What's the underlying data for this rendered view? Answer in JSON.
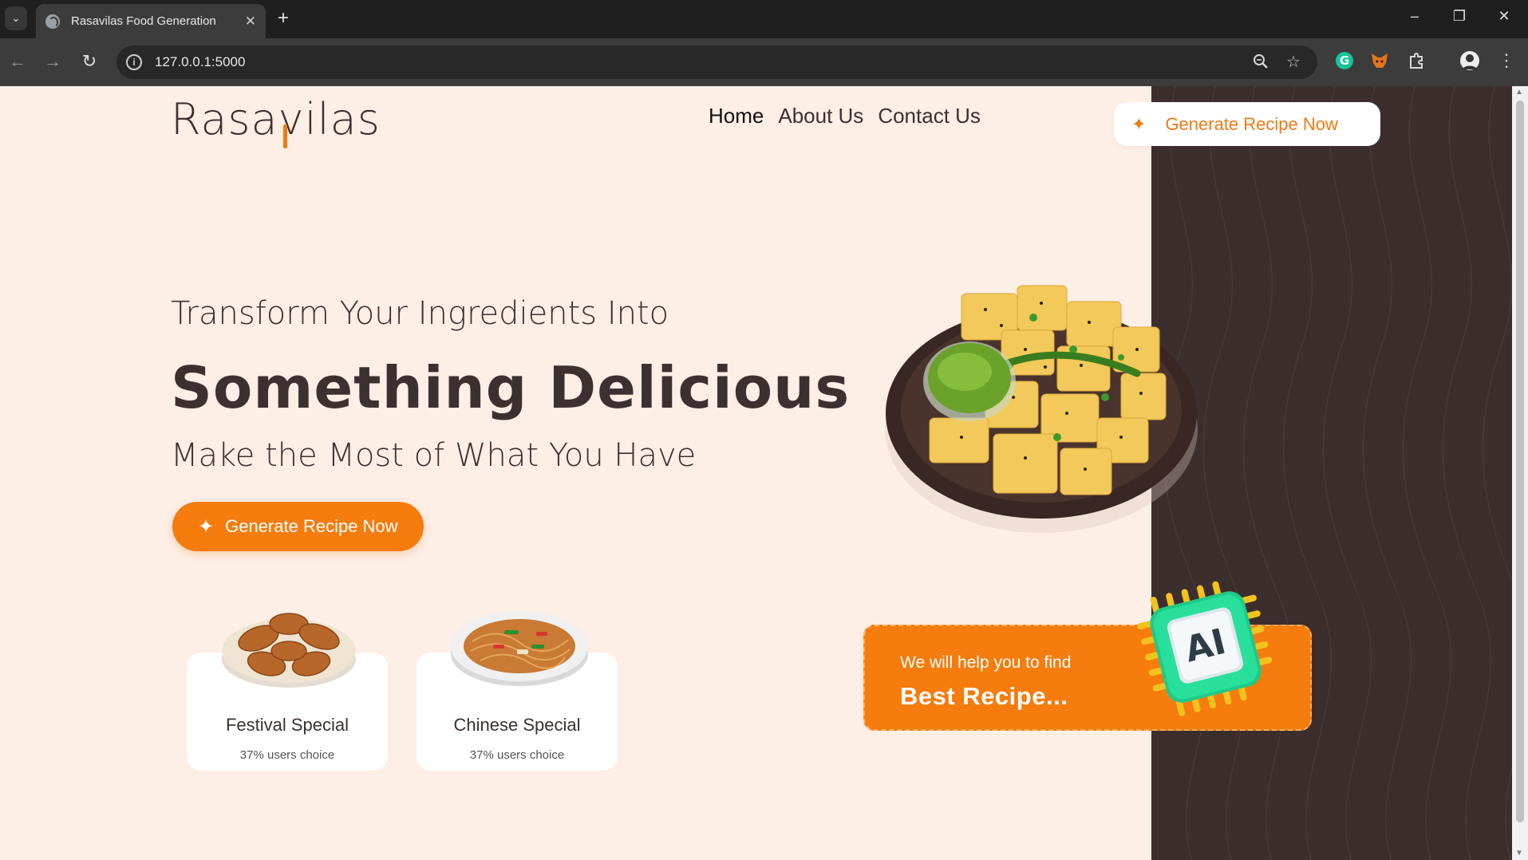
{
  "browser": {
    "tab_title": "Rasavilas Food Generation",
    "url": "127.0.0.1:5000",
    "new_tab_label": "+",
    "tab_close_glyph": "✕"
  },
  "header": {
    "logo": "Rasavilas",
    "nav": [
      "Home",
      "About Us",
      "Contact Us"
    ],
    "cta_label": "Generate Recipe Now"
  },
  "hero": {
    "pre_title": "Transform Your Ingredients Into",
    "title": "Something Delicious",
    "subtitle": "Make the Most of What You Have",
    "cta_label": "Generate Recipe Now"
  },
  "cards": [
    {
      "title": "Festival Special",
      "subtitle": "37% users choice"
    },
    {
      "title": "Chinese Special",
      "subtitle": "37% users choice"
    }
  ],
  "promo": {
    "small_text": "We will help you to find",
    "big_text": "Best Recipe...",
    "badge_text": "AI"
  },
  "colors": {
    "accent": "#f57c0d",
    "page_bg": "#fdeee6",
    "dark_panel": "#3d2e2e",
    "text": "#3d3030"
  }
}
